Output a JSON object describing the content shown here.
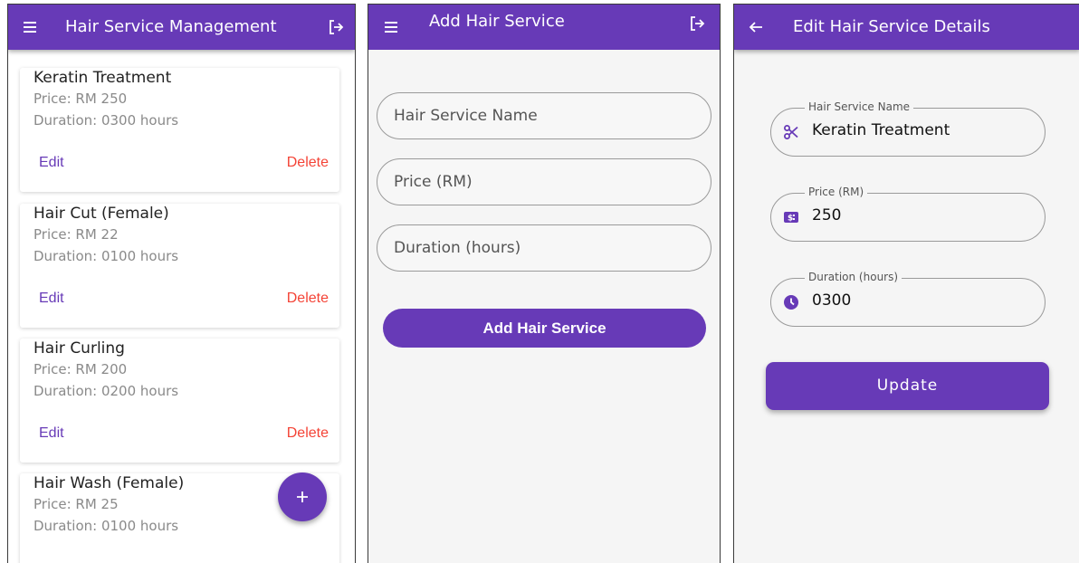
{
  "colors": {
    "primary": "#673ab7",
    "delete": "#f44336",
    "background": "#f5f5f5"
  },
  "list_screen": {
    "title": "Hair Service Management",
    "menu_icon": "menu-icon",
    "logout_icon": "logout-icon",
    "services": [
      {
        "name": "Keratin Treatment",
        "price": "Price: RM 250",
        "duration": "Duration: 0300 hours",
        "edit": "Edit",
        "delete": "Delete"
      },
      {
        "name": "Hair Cut (Female)",
        "price": "Price: RM 22",
        "duration": "Duration: 0100 hours",
        "edit": "Edit",
        "delete": "Delete"
      },
      {
        "name": "Hair Curling",
        "price": "Price: RM 200",
        "duration": "Duration: 0200 hours",
        "edit": "Edit",
        "delete": "Delete"
      },
      {
        "name": "Hair Wash (Female)",
        "price": "Price: RM 25",
        "duration": "Duration: 0100 hours"
      }
    ],
    "fab_icon": "plus-icon"
  },
  "add_screen": {
    "title": "Add Hair Service",
    "name_placeholder": "Hair Service Name",
    "price_placeholder": "Price (RM)",
    "duration_placeholder": "Duration (hours)",
    "submit_label": "Add Hair Service"
  },
  "edit_screen": {
    "title": "Edit Hair Service Details",
    "back_icon": "arrow-back-icon",
    "fields": {
      "name": {
        "label": "Hair Service Name",
        "value": "Keratin Treatment",
        "icon": "scissors-icon"
      },
      "price": {
        "label": "Price (RM)",
        "value": "250",
        "icon": "money-icon"
      },
      "duration": {
        "label": "Duration (hours)",
        "value": "0300",
        "icon": "clock-icon"
      }
    },
    "update_label": "Update"
  }
}
